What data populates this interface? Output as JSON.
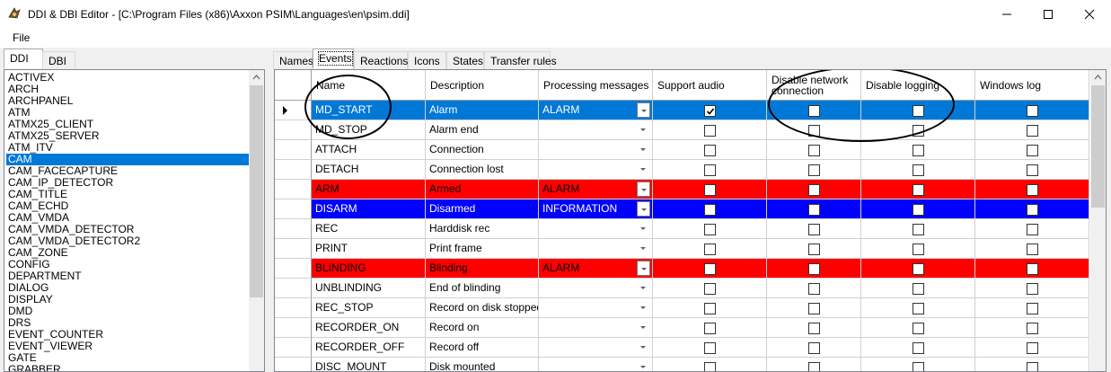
{
  "window": {
    "title": "DDI & DBI Editor - [C:\\Program Files (x86)\\Axxon PSIM\\Languages\\en\\psim.ddi]"
  },
  "menu": {
    "file": "File"
  },
  "left_tabs": [
    {
      "label": "DDI"
    },
    {
      "label": "DBI"
    }
  ],
  "left_list": {
    "items": [
      "ACTIVEX",
      "ARCH",
      "ARCHPANEL",
      "ATM",
      "ATMX25_CLIENT",
      "ATMX25_SERVER",
      "ATM_ITV",
      "CAM",
      "CAM_FACECAPTURE",
      "CAM_IP_DETECTOR",
      "CAM_TITLE",
      "CAM_ECHD",
      "CAM_VMDA",
      "CAM_VMDA_DETECTOR",
      "CAM_VMDA_DETECTOR2",
      "CAM_ZONE",
      "CONFIG",
      "DEPARTMENT",
      "DIALOG",
      "DISPLAY",
      "DMD",
      "DRS",
      "EVENT_COUNTER",
      "EVENT_VIEWER",
      "GATE",
      "GRABBER"
    ],
    "selected": "CAM"
  },
  "right_tabs": [
    {
      "label": "Names"
    },
    {
      "label": "Events"
    },
    {
      "label": "Reactions"
    },
    {
      "label": "Icons"
    },
    {
      "label": "States"
    },
    {
      "label": "Transfer rules"
    }
  ],
  "grid": {
    "columns": [
      "Name",
      "Description",
      "Processing messages",
      "Support audio",
      "Disable network connection",
      "Disable logging",
      "Windows log"
    ],
    "rows": [
      {
        "name": "MD_START",
        "description": "Alarm",
        "processing": "ALARM",
        "support_audio": true,
        "disable_network": false,
        "disable_logging": false,
        "windows_log": false
      },
      {
        "name": "MD_STOP",
        "description": "Alarm end",
        "processing": "",
        "support_audio": false,
        "disable_network": false,
        "disable_logging": false,
        "windows_log": false
      },
      {
        "name": "ATTACH",
        "description": "Connection",
        "processing": "",
        "support_audio": false,
        "disable_network": false,
        "disable_logging": false,
        "windows_log": false
      },
      {
        "name": "DETACH",
        "description": "Connection lost",
        "processing": "",
        "support_audio": false,
        "disable_network": false,
        "disable_logging": false,
        "windows_log": false
      },
      {
        "name": "ARM",
        "description": "Armed",
        "processing": "ALARM",
        "support_audio": false,
        "disable_network": false,
        "disable_logging": false,
        "windows_log": false
      },
      {
        "name": "DISARM",
        "description": "Disarmed",
        "processing": "INFORMATION",
        "support_audio": false,
        "disable_network": false,
        "disable_logging": false,
        "windows_log": false
      },
      {
        "name": "REC",
        "description": "Harddisk rec",
        "processing": "",
        "support_audio": false,
        "disable_network": false,
        "disable_logging": false,
        "windows_log": false
      },
      {
        "name": "PRINT",
        "description": "Print frame",
        "processing": "",
        "support_audio": false,
        "disable_network": false,
        "disable_logging": false,
        "windows_log": false
      },
      {
        "name": "BLINDING",
        "description": "Blinding",
        "processing": "ALARM",
        "support_audio": false,
        "disable_network": false,
        "disable_logging": false,
        "windows_log": false
      },
      {
        "name": "UNBLINDING",
        "description": "End of blinding",
        "processing": "",
        "support_audio": false,
        "disable_network": false,
        "disable_logging": false,
        "windows_log": false
      },
      {
        "name": "REC_STOP",
        "description": "Record on disk stopped",
        "processing": "",
        "support_audio": false,
        "disable_network": false,
        "disable_logging": false,
        "windows_log": false
      },
      {
        "name": "RECORDER_ON",
        "description": "Record on",
        "processing": "",
        "support_audio": false,
        "disable_network": false,
        "disable_logging": false,
        "windows_log": false
      },
      {
        "name": "RECORDER_OFF",
        "description": "Record off",
        "processing": "",
        "support_audio": false,
        "disable_network": false,
        "disable_logging": false,
        "windows_log": false
      },
      {
        "name": "DISC_MOUNT",
        "description": "Disk mounted",
        "processing": "",
        "support_audio": false,
        "disable_network": false,
        "disable_logging": false,
        "windows_log": false
      }
    ]
  },
  "colors": {
    "selection": "#0078d7",
    "alarm": "#ff0000",
    "information": "#0000ff"
  }
}
